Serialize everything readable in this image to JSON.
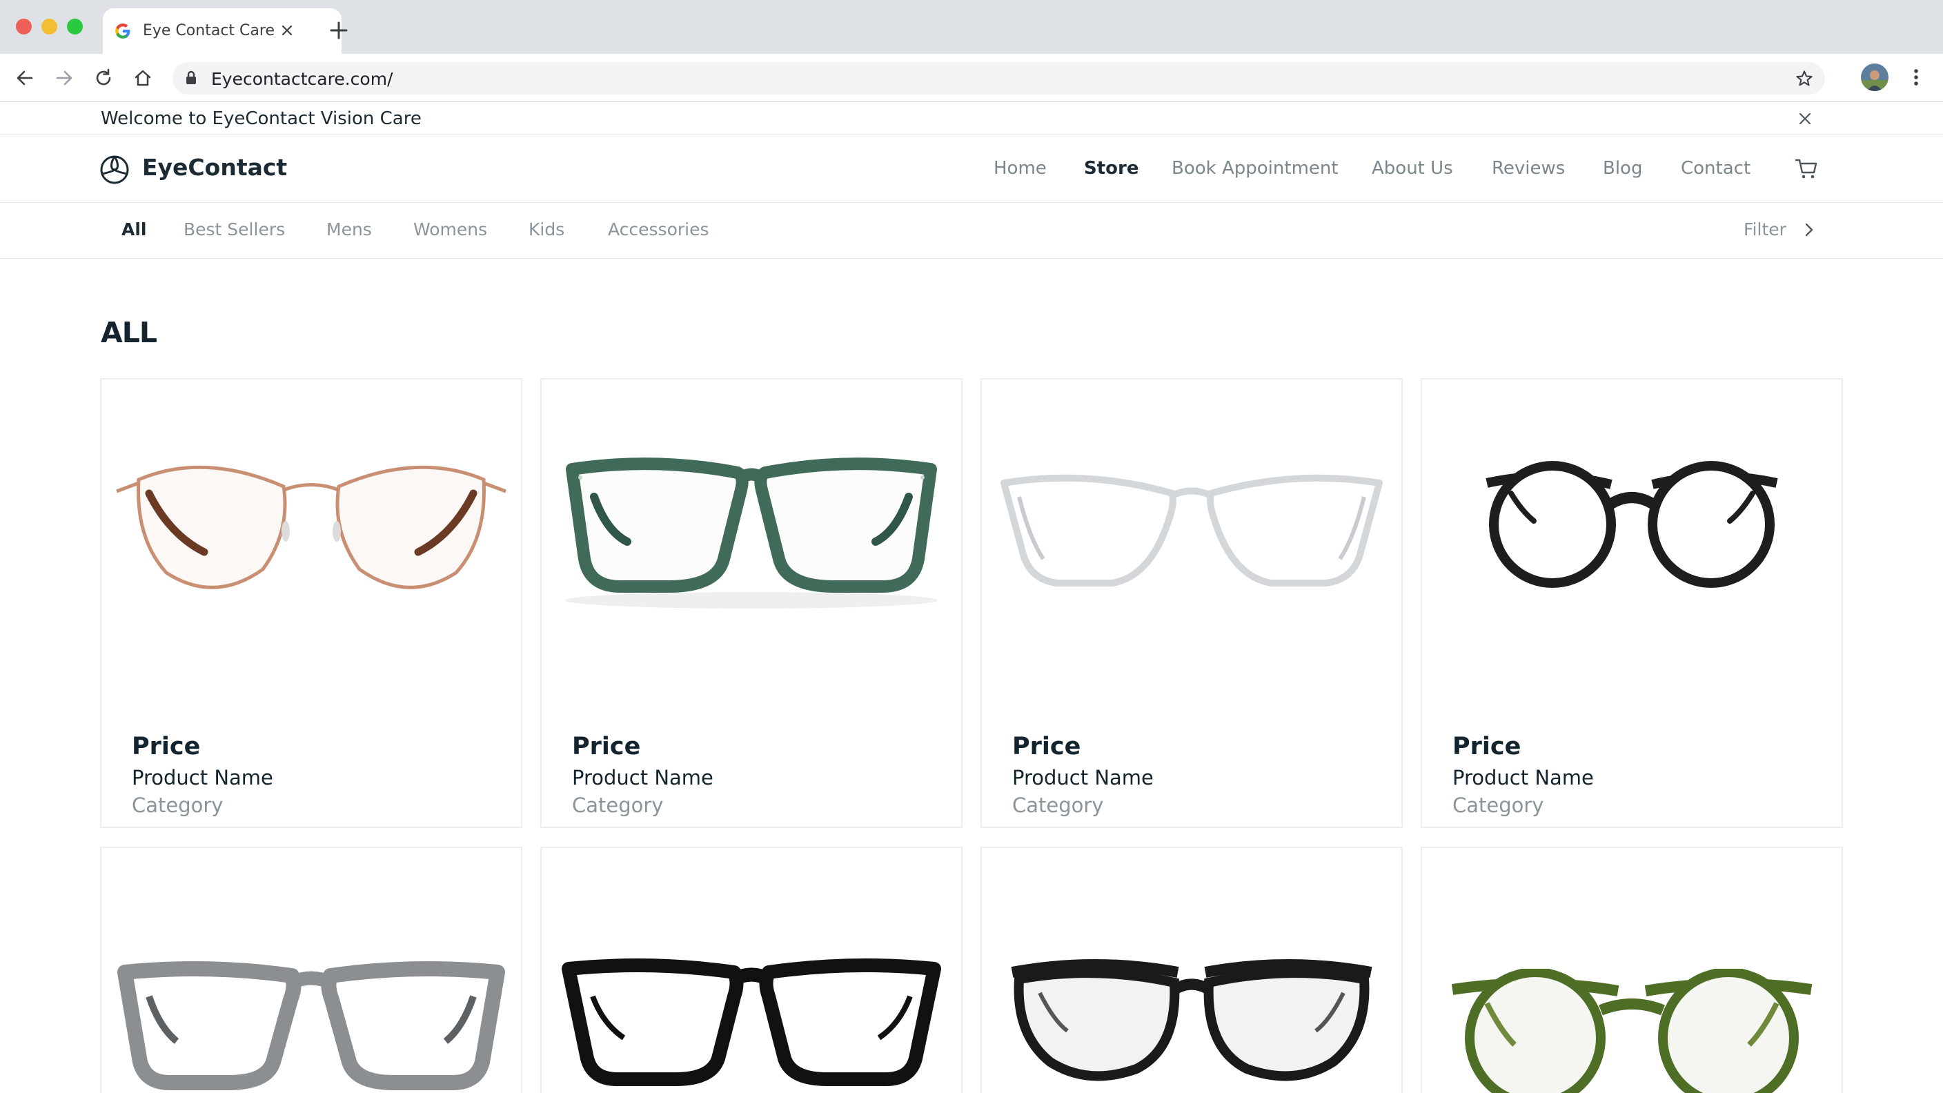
{
  "browser": {
    "tab_title": "Eye Contact Care",
    "url": "Eyecontactcare.com/"
  },
  "banner": {
    "text": "Welcome to EyeContact Vision Care"
  },
  "header": {
    "logo_text": "EyeContact",
    "nav": [
      {
        "label": "Home"
      },
      {
        "label": "Store"
      },
      {
        "label": "Book Appointment"
      },
      {
        "label": "About Us"
      },
      {
        "label": "Reviews"
      },
      {
        "label": "Blog"
      },
      {
        "label": "Contact"
      }
    ],
    "active_nav": "Store",
    "cart_icon": "cart-icon"
  },
  "subnav": {
    "items": [
      {
        "label": "All"
      },
      {
        "label": "Best Sellers"
      },
      {
        "label": "Mens"
      },
      {
        "label": "Womens"
      },
      {
        "label": "Kids"
      },
      {
        "label": "Accessories"
      }
    ],
    "active": "All",
    "filter_label": "Filter"
  },
  "main": {
    "title": "ALL",
    "products": [
      {
        "price": "Price",
        "name": "Product Name",
        "category": "Category",
        "frame": "gold-cat-eye",
        "color": "#c98f72"
      },
      {
        "price": "Price",
        "name": "Product Name",
        "category": "Category",
        "frame": "green-square",
        "color": "#3f6b58"
      },
      {
        "price": "Price",
        "name": "Product Name",
        "category": "Category",
        "frame": "clear-rectangle",
        "color": "#d9dcde"
      },
      {
        "price": "Price",
        "name": "Product Name",
        "category": "Category",
        "frame": "black-round",
        "color": "#1e1e1e"
      },
      {
        "frame": "grey-square",
        "color": "#8b8f92"
      },
      {
        "frame": "black-square",
        "color": "#111111"
      },
      {
        "frame": "black-round-clear",
        "color": "#1a1a1a"
      },
      {
        "frame": "olive-round",
        "color": "#4f6e25"
      }
    ]
  }
}
